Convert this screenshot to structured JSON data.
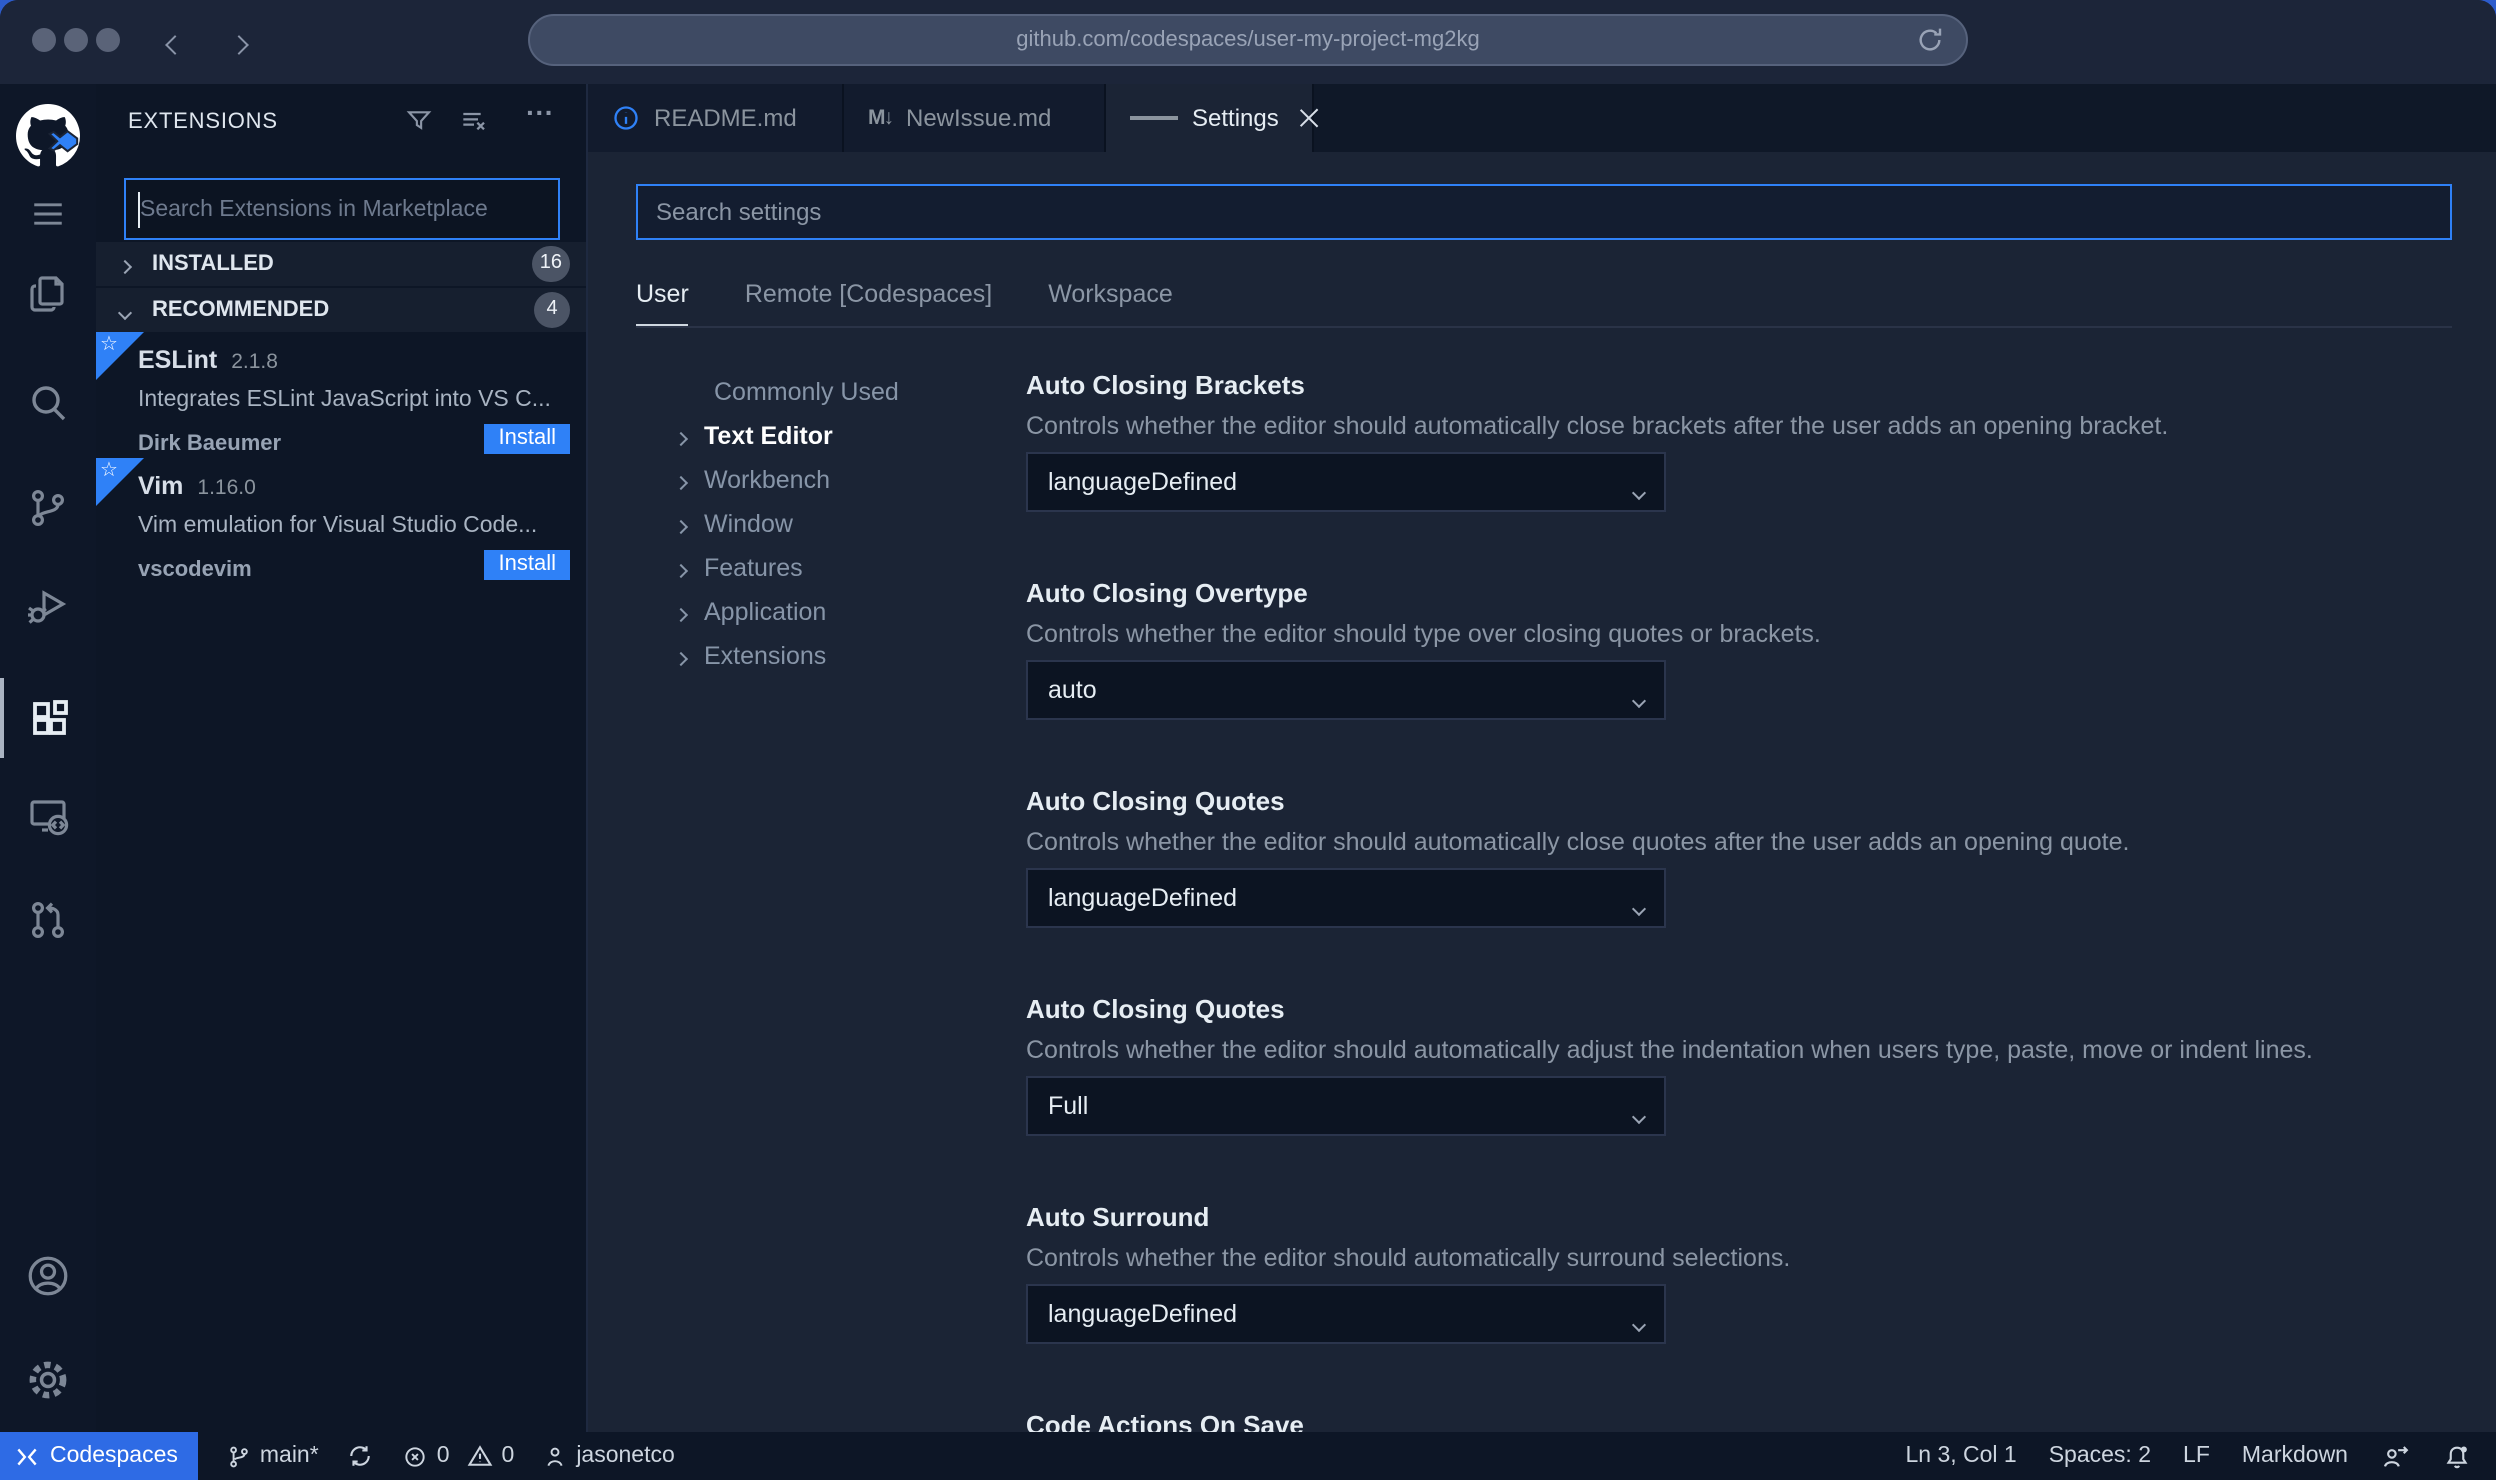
{
  "colors": {
    "accent": "#2f81f7",
    "install_button": "#2f81f7",
    "focus_border": "#2f81f7",
    "codespaces_chip": "#2e6be5",
    "editor_bg": "#1b2435",
    "sidebar_bg": "#0d1626"
  },
  "browser": {
    "url": "github.com/codespaces/user-my-project-mg2kg"
  },
  "icons": {
    "markdown": "M↓",
    "ellipsis": "···",
    "star": "☆"
  },
  "sidebar": {
    "title": "EXTENSIONS",
    "search_placeholder": "Search Extensions in Marketplace",
    "sections": [
      {
        "label": "INSTALLED",
        "count": "16"
      },
      {
        "label": "RECOMMENDED",
        "count": "4"
      }
    ],
    "extensions": [
      {
        "name": "ESLint",
        "version": "2.1.8",
        "description": "Integrates ESLint JavaScript into VS C...",
        "publisher": "Dirk Baeumer",
        "action": "Install"
      },
      {
        "name": "Vim",
        "version": "1.16.0",
        "description": "Vim emulation for Visual Studio Code...",
        "publisher": "vscodevim",
        "action": "Install"
      }
    ]
  },
  "tabs": [
    {
      "label": "README.md"
    },
    {
      "label": "NewIssue.md"
    },
    {
      "label": "Settings"
    }
  ],
  "settings": {
    "search_placeholder": "Search settings",
    "scopes": [
      {
        "label": "User"
      },
      {
        "label": "Remote [Codespaces]"
      },
      {
        "label": "Workspace"
      }
    ],
    "toc": [
      {
        "label": "Commonly Used"
      },
      {
        "label": "Text Editor"
      },
      {
        "label": "Workbench"
      },
      {
        "label": "Window"
      },
      {
        "label": "Features"
      },
      {
        "label": "Application"
      },
      {
        "label": "Extensions"
      }
    ],
    "items": [
      {
        "title": "Auto Closing Brackets",
        "description": "Controls whether the editor should automatically close brackets after the user adds an opening bracket.",
        "value": "languageDefined"
      },
      {
        "title": "Auto Closing Overtype",
        "description": "Controls whether the editor should type over closing quotes or brackets.",
        "value": "auto"
      },
      {
        "title": "Auto Closing Quotes",
        "description": "Controls whether the editor should automatically close quotes after the user adds an opening quote.",
        "value": "languageDefined"
      },
      {
        "title": "Auto Closing Quotes",
        "description": "Controls whether the editor should automatically adjust the indentation when users type, paste, move or indent lines.",
        "value": "Full"
      },
      {
        "title": "Auto Surround",
        "description": "Controls whether the editor should automatically surround selections.",
        "value": "languageDefined"
      },
      {
        "title": "Code Actions On Save"
      }
    ]
  },
  "status_bar": {
    "codespaces": "Codespaces",
    "branch": "main*",
    "errors": "0",
    "warnings": "0",
    "user": "jasonetco",
    "cursor": "Ln 3, Col 1",
    "indent": "Spaces: 2",
    "eol": "LF",
    "language": "Markdown"
  }
}
